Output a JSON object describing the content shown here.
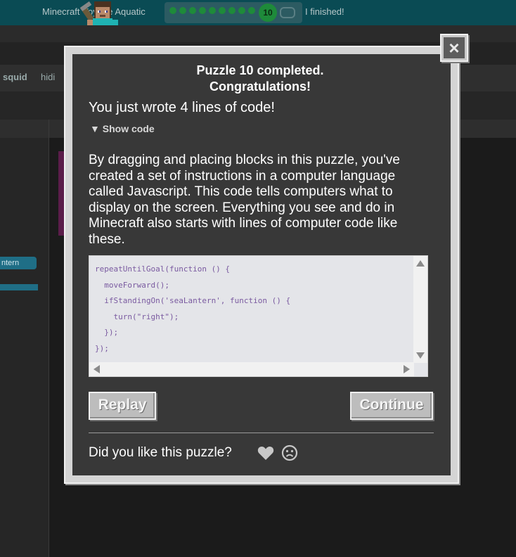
{
  "header": {
    "course_title": "Minecraft Voyage Aquatic",
    "progress": {
      "total_puzzles": 10,
      "current_level": "10",
      "completed": 9
    },
    "finished_label": "I finished!"
  },
  "background": {
    "toolbox_items": [
      "squid",
      "hidi"
    ],
    "block_chip_label": "ntern"
  },
  "dialog": {
    "title_line1": "Puzzle 10 completed.",
    "title_line2": "Congratulations!",
    "lines_of_code": "You just wrote 4 lines of code!",
    "show_code": "▼ Show code",
    "explanation": "By dragging and placing blocks in this puzzle, you've created a set of instructions in a computer language called Javascript. This code tells computers what to display on the screen. Everything you see and do in Minecraft also starts with lines of computer code like these.",
    "code": "repeatUntilGoal(function () {\n  moveForward();\n  ifStandingOn('seaLantern', function () {\n    turn(\"right\");\n  });\n});",
    "replay_label": "Replay",
    "continue_label": "Continue",
    "feedback_question": "Did you like this puzzle?",
    "close_icon": "×"
  },
  "colors": {
    "header_bg": "#0a4b54",
    "progress_green": "#1e8a3a",
    "dialog_bg": "#383838",
    "button_bg": "#bdbdbd",
    "code_text": "#7a5aa0"
  }
}
